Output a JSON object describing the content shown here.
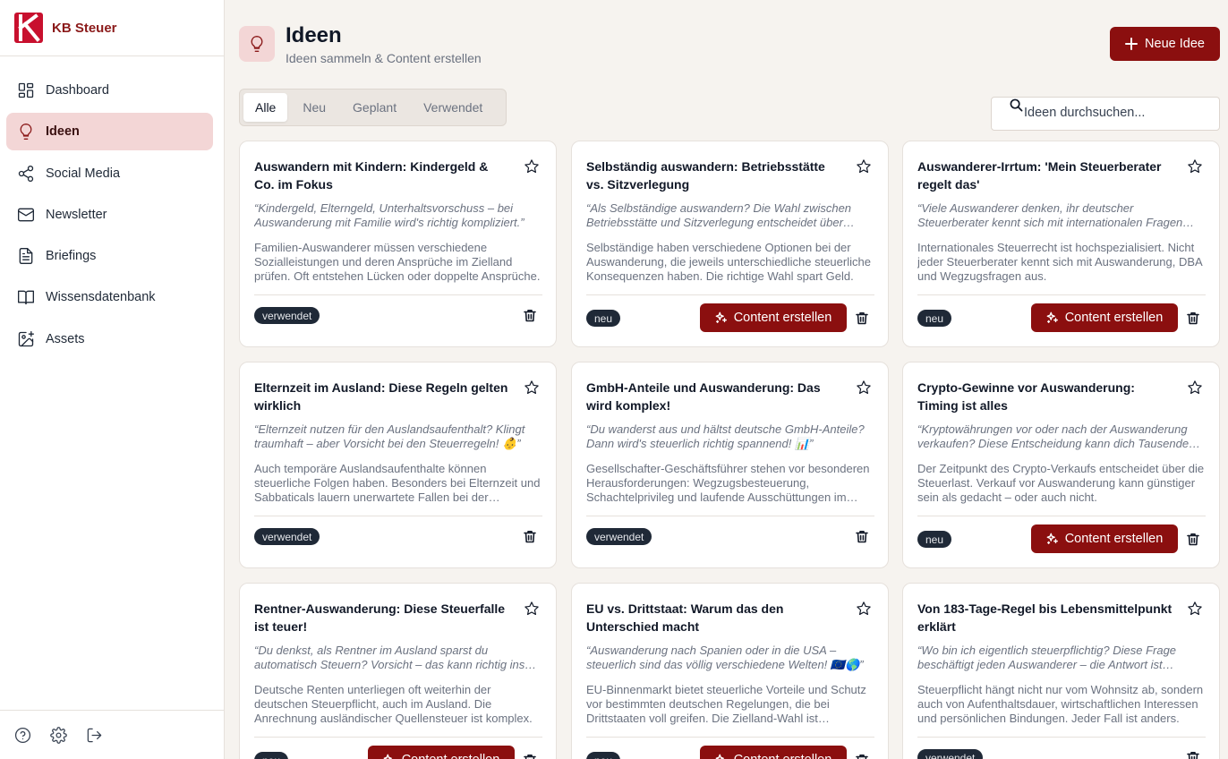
{
  "brand": {
    "name": "KB Steuer",
    "logo_letter": "K"
  },
  "sidebar": {
    "items": [
      {
        "label": "Dashboard",
        "icon": "dashboard-icon"
      },
      {
        "label": "Ideen",
        "icon": "lightbulb-icon",
        "active": true
      },
      {
        "label": "Social Media",
        "icon": "share-icon"
      },
      {
        "label": "Newsletter",
        "icon": "mail-icon"
      },
      {
        "label": "Briefings",
        "icon": "document-icon"
      },
      {
        "label": "Wissensdatenbank",
        "icon": "book-icon"
      },
      {
        "label": "Assets",
        "icon": "image-plus-icon"
      }
    ],
    "footer_icons": [
      "help-icon",
      "settings-icon",
      "logout-icon"
    ]
  },
  "header": {
    "title": "Ideen",
    "subtitle": "Ideen sammeln & Content erstellen",
    "new_button": "Neue Idee"
  },
  "tabs": [
    "Alle",
    "Neu",
    "Geplant",
    "Verwendet"
  ],
  "active_tab": "Alle",
  "search": {
    "placeholder": "Ideen durchsuchen..."
  },
  "content_button_label": "Content erstellen",
  "colors": {
    "brand": "#8b0f0f",
    "active_nav_bg": "#f3d6d6",
    "badge_bg": "#1f2937"
  },
  "cards": [
    {
      "title": "Auswandern mit Kindern: Kindergeld & Co. im Fokus",
      "quote": "“Kindergeld, Elterngeld, Unterhaltsvorschuss – bei Auswanderung mit Familie wird's richtig kompliziert.”",
      "description": "Familien-Auswanderer müssen verschiedene Sozialleistungen und deren Ansprüche im Zielland prüfen. Oft entstehen Lücken oder doppelte Ansprüche.",
      "status": "verwendet"
    },
    {
      "title": "Selbständig auswandern: Betriebsstätte vs. Sitzverlegung",
      "quote": "“Als Selbständige auswandern? Die Wahl zwischen Betriebsstätte und Sitzverlegung entscheidet über deine Steuerlast.”",
      "description": "Selbständige haben verschiedene Optionen bei der Auswanderung, die jeweils unterschiedliche steuerliche Konsequenzen haben. Die richtige Wahl spart Geld.",
      "status": "neu"
    },
    {
      "title": "Auswanderer-Irrtum: 'Mein Steuerberater regelt das'",
      "quote": "“Viele Auswanderer denken, ihr deutscher Steuerberater kennt sich mit internationalen Fragen aus.”",
      "description": "Internationales Steuerrecht ist hochspezialisiert. Nicht jeder Steuerberater kennt sich mit Auswanderung, DBA und Wegzugsfragen aus.",
      "status": "neu"
    },
    {
      "title": "Elternzeit im Ausland: Diese Regeln gelten wirklich",
      "quote": "“Elternzeit nutzen für den Auslandsaufenthalt? Klingt traumhaft – aber Vorsicht bei den Steuerregeln! 👶”",
      "description": "Auch temporäre Auslandsaufenthalte können steuerliche Folgen haben. Besonders bei Elternzeit und Sabbaticals lauern unerwartete Fallen bei der Rückkehr.",
      "status": "verwendet"
    },
    {
      "title": "GmbH-Anteile und Auswanderung: Das wird komplex!",
      "quote": "“Du wanderst aus und hältst deutsche GmbH-Anteile? Dann wird's steuerlich richtig spannend! 📊”",
      "description": "Gesellschafter-Geschäftsführer stehen vor besonderen Herausforderungen: Wegzugsbesteuerung, Schachtelprivileg und laufende Ausschüttungen im Ausland.",
      "status": "verwendet"
    },
    {
      "title": "Crypto-Gewinne vor Auswanderung: Timing ist alles",
      "quote": "“Kryptowährungen vor oder nach der Auswanderung verkaufen? Diese Entscheidung kann dich Tausende kosten.”",
      "description": "Der Zeitpunkt des Crypto-Verkaufs entscheidet über die Steuerlast. Verkauf vor Auswanderung kann günstiger sein als gedacht – oder auch nicht.",
      "status": "neu"
    },
    {
      "title": "Rentner-Auswanderung: Diese Steuerfalle ist teuer!",
      "quote": "“Du denkst, als Rentner im Ausland sparst du automatisch Steuern? Vorsicht – das kann richtig ins Auge gehen.”",
      "description": "Deutsche Renten unterliegen oft weiterhin der deutschen Steuerpflicht, auch im Ausland. Die Anrechnung ausländischer Quellensteuer ist komplex.",
      "status": "neu"
    },
    {
      "title": "EU vs. Drittstaat: Warum das den Unterschied macht",
      "quote": "“Auswanderung nach Spanien oder in die USA – steuerlich sind das völlig verschiedene Welten! 🇪🇺🌎”",
      "description": "EU-Binnenmarkt bietet steuerliche Vorteile und Schutz vor bestimmten deutschen Regelungen, die bei Drittstaaten voll greifen. Die Zielland-Wahl ist entscheidend.",
      "status": "neu"
    },
    {
      "title": "Von 183-Tage-Regel bis Lebensmittelpunkt erklärt",
      "quote": "“Wo bin ich eigentlich steuerpflichtig? Diese Frage beschäftigt jeden Auswanderer – die Antwort ist komplizierter.”",
      "description": "Steuerpflicht hängt nicht nur vom Wohnsitz ab, sondern auch von Aufenthaltsdauer, wirtschaftlichen Interessen und persönlichen Bindungen. Jeder Fall ist anders.",
      "status": "verwendet"
    }
  ]
}
